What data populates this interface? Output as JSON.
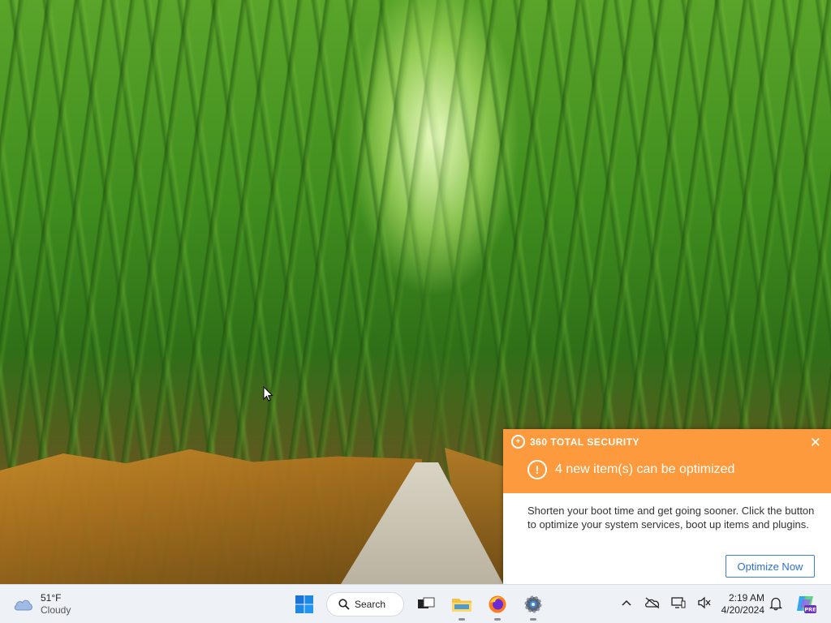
{
  "toast": {
    "brand": "360 TOTAL SECURITY",
    "close_glyph": "✕",
    "headline": "4 new item(s) can be optimized",
    "warn_glyph": "!",
    "body": "Shorten your boot time and get going sooner. Click the button to optimize your system services, boot up items and plugins.",
    "button": "Optimize Now",
    "accent": "#fc9a3d"
  },
  "taskbar": {
    "weather": {
      "temp": "51°F",
      "condition": "Cloudy",
      "icon": "cloud-icon"
    },
    "search_label": "Search",
    "pinned": [
      {
        "name": "start",
        "icon": "windows-logo-icon"
      },
      {
        "name": "search",
        "icon": "search-icon"
      },
      {
        "name": "task-view",
        "icon": "task-view-icon"
      },
      {
        "name": "file-explorer",
        "icon": "folder-icon"
      },
      {
        "name": "firefox",
        "icon": "firefox-icon"
      },
      {
        "name": "settings",
        "icon": "gear-icon"
      }
    ],
    "tray": {
      "chevron": "^",
      "icons": [
        "chevron-up-icon",
        "onedrive-offline-icon",
        "network-icon",
        "volume-muted-icon"
      ],
      "time": "2:19 AM",
      "date": "4/20/2024",
      "notification_icon": "bell-icon",
      "copilot_badge": "PRE"
    }
  }
}
